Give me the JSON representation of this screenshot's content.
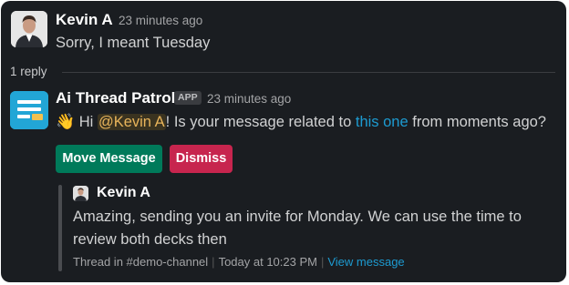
{
  "message1": {
    "author": "Kevin A",
    "time": "23 minutes ago",
    "text": "Sorry, I meant Tuesday"
  },
  "thread": {
    "reply_count_label": "1 reply"
  },
  "bot_message": {
    "author": "Ai Thread Patrol",
    "badge": "APP",
    "time": "23 minutes ago",
    "emoji": "👋",
    "text_hi": "Hi",
    "mention": "@Kevin A",
    "text_mid": "! Is your message related to",
    "link_text": "this one",
    "text_end": "from moments ago?",
    "buttons": {
      "move": "Move Message",
      "dismiss": "Dismiss"
    }
  },
  "quoted": {
    "author": "Kevin A",
    "line1": "Amazing, sending you an invite for Monday. We can use the time to",
    "line2": "review both decks then",
    "meta_thread": "Thread in",
    "channel_icon": "#",
    "channel": "demo-channel",
    "meta_time": "Today at 10:23 PM",
    "meta_link": "View message"
  },
  "colors": {
    "background": "#1a1d21",
    "move_button": "#007a5a",
    "dismiss_button": "#c7254e",
    "link": "#1d9bd1",
    "mention": "#e8b45b",
    "bot_avatar": "#22a6d6"
  },
  "icons": {
    "wave": "waving-hand-emoji",
    "bot": "thread-patrol-logo",
    "channel": "hash-icon"
  }
}
